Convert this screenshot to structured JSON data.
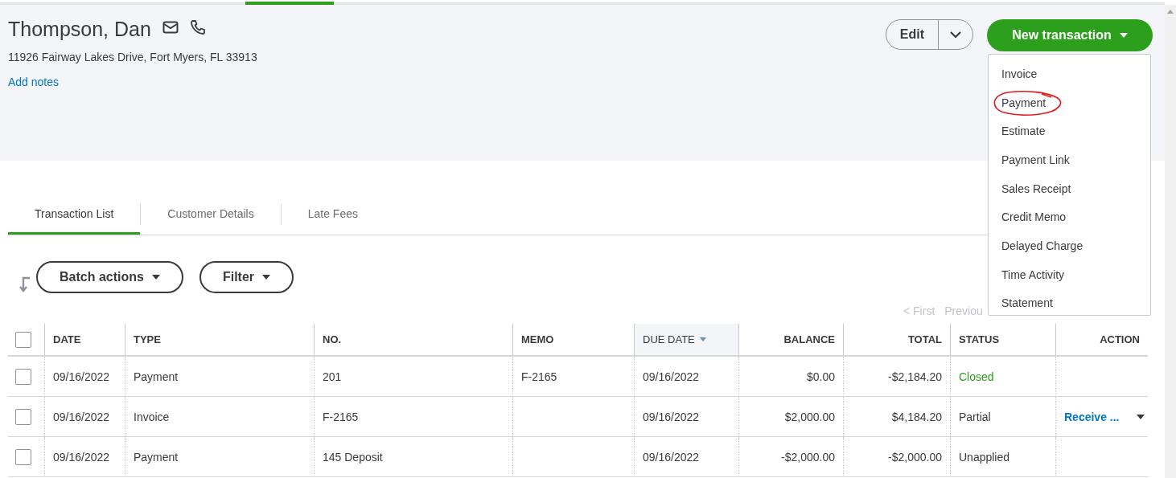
{
  "customer": {
    "name": "Thompson, Dan",
    "address": "11926 Fairway Lakes Drive, Fort Myers, FL 33913",
    "notes_link": "Add notes"
  },
  "header_buttons": {
    "edit": "Edit",
    "new_transaction": "New transaction"
  },
  "new_transaction_menu": [
    {
      "label": "Invoice",
      "circled": false
    },
    {
      "label": "Payment",
      "circled": true
    },
    {
      "label": "Estimate",
      "circled": false
    },
    {
      "label": "Payment Link",
      "circled": false
    },
    {
      "label": "Sales Receipt",
      "circled": false
    },
    {
      "label": "Credit Memo",
      "circled": false
    },
    {
      "label": "Delayed Charge",
      "circled": false
    },
    {
      "label": "Time Activity",
      "circled": false
    },
    {
      "label": "Statement",
      "circled": false
    }
  ],
  "tabs": [
    {
      "label": "Transaction List",
      "selected": true
    },
    {
      "label": "Customer Details",
      "selected": false
    },
    {
      "label": "Late Fees",
      "selected": false
    }
  ],
  "toolbar": {
    "batch_actions": "Batch actions",
    "filter": "Filter"
  },
  "pagination": [
    "< First",
    "Previou"
  ],
  "table": {
    "select_all_checked": false,
    "columns": [
      {
        "label": "DATE",
        "sorted": false
      },
      {
        "label": "TYPE",
        "sorted": false
      },
      {
        "label": "NO.",
        "sorted": false
      },
      {
        "label": "MEMO",
        "sorted": false
      },
      {
        "label": "DUE DATE",
        "sorted": true
      },
      {
        "label": "BALANCE",
        "sorted": false
      },
      {
        "label": "TOTAL",
        "sorted": false
      },
      {
        "label": "STATUS",
        "sorted": false
      },
      {
        "label": "ACTION",
        "sorted": false
      }
    ],
    "rows": [
      {
        "checked": false,
        "cells": [
          "09/16/2022",
          "Payment",
          "201",
          "F-2165",
          "09/16/2022",
          "$0.00",
          "-$2,184.20"
        ],
        "status": {
          "text": "Closed",
          "color": "#2ca01c"
        }
      },
      {
        "checked": false,
        "cells": [
          "09/16/2022",
          "Invoice",
          "F-2165",
          "",
          "09/16/2022",
          "$2,000.00",
          "$4,184.20"
        ],
        "status": {
          "text": "Partial",
          "color": "#393a3d"
        },
        "action": "Receive ..."
      },
      {
        "checked": false,
        "cells": [
          "09/16/2022",
          "Payment",
          "145 Deposit",
          "",
          "09/16/2022",
          "-$2,000.00",
          "-$2,000.00"
        ],
        "status": {
          "text": "Unapplied",
          "color": "#393a3d"
        }
      }
    ]
  }
}
